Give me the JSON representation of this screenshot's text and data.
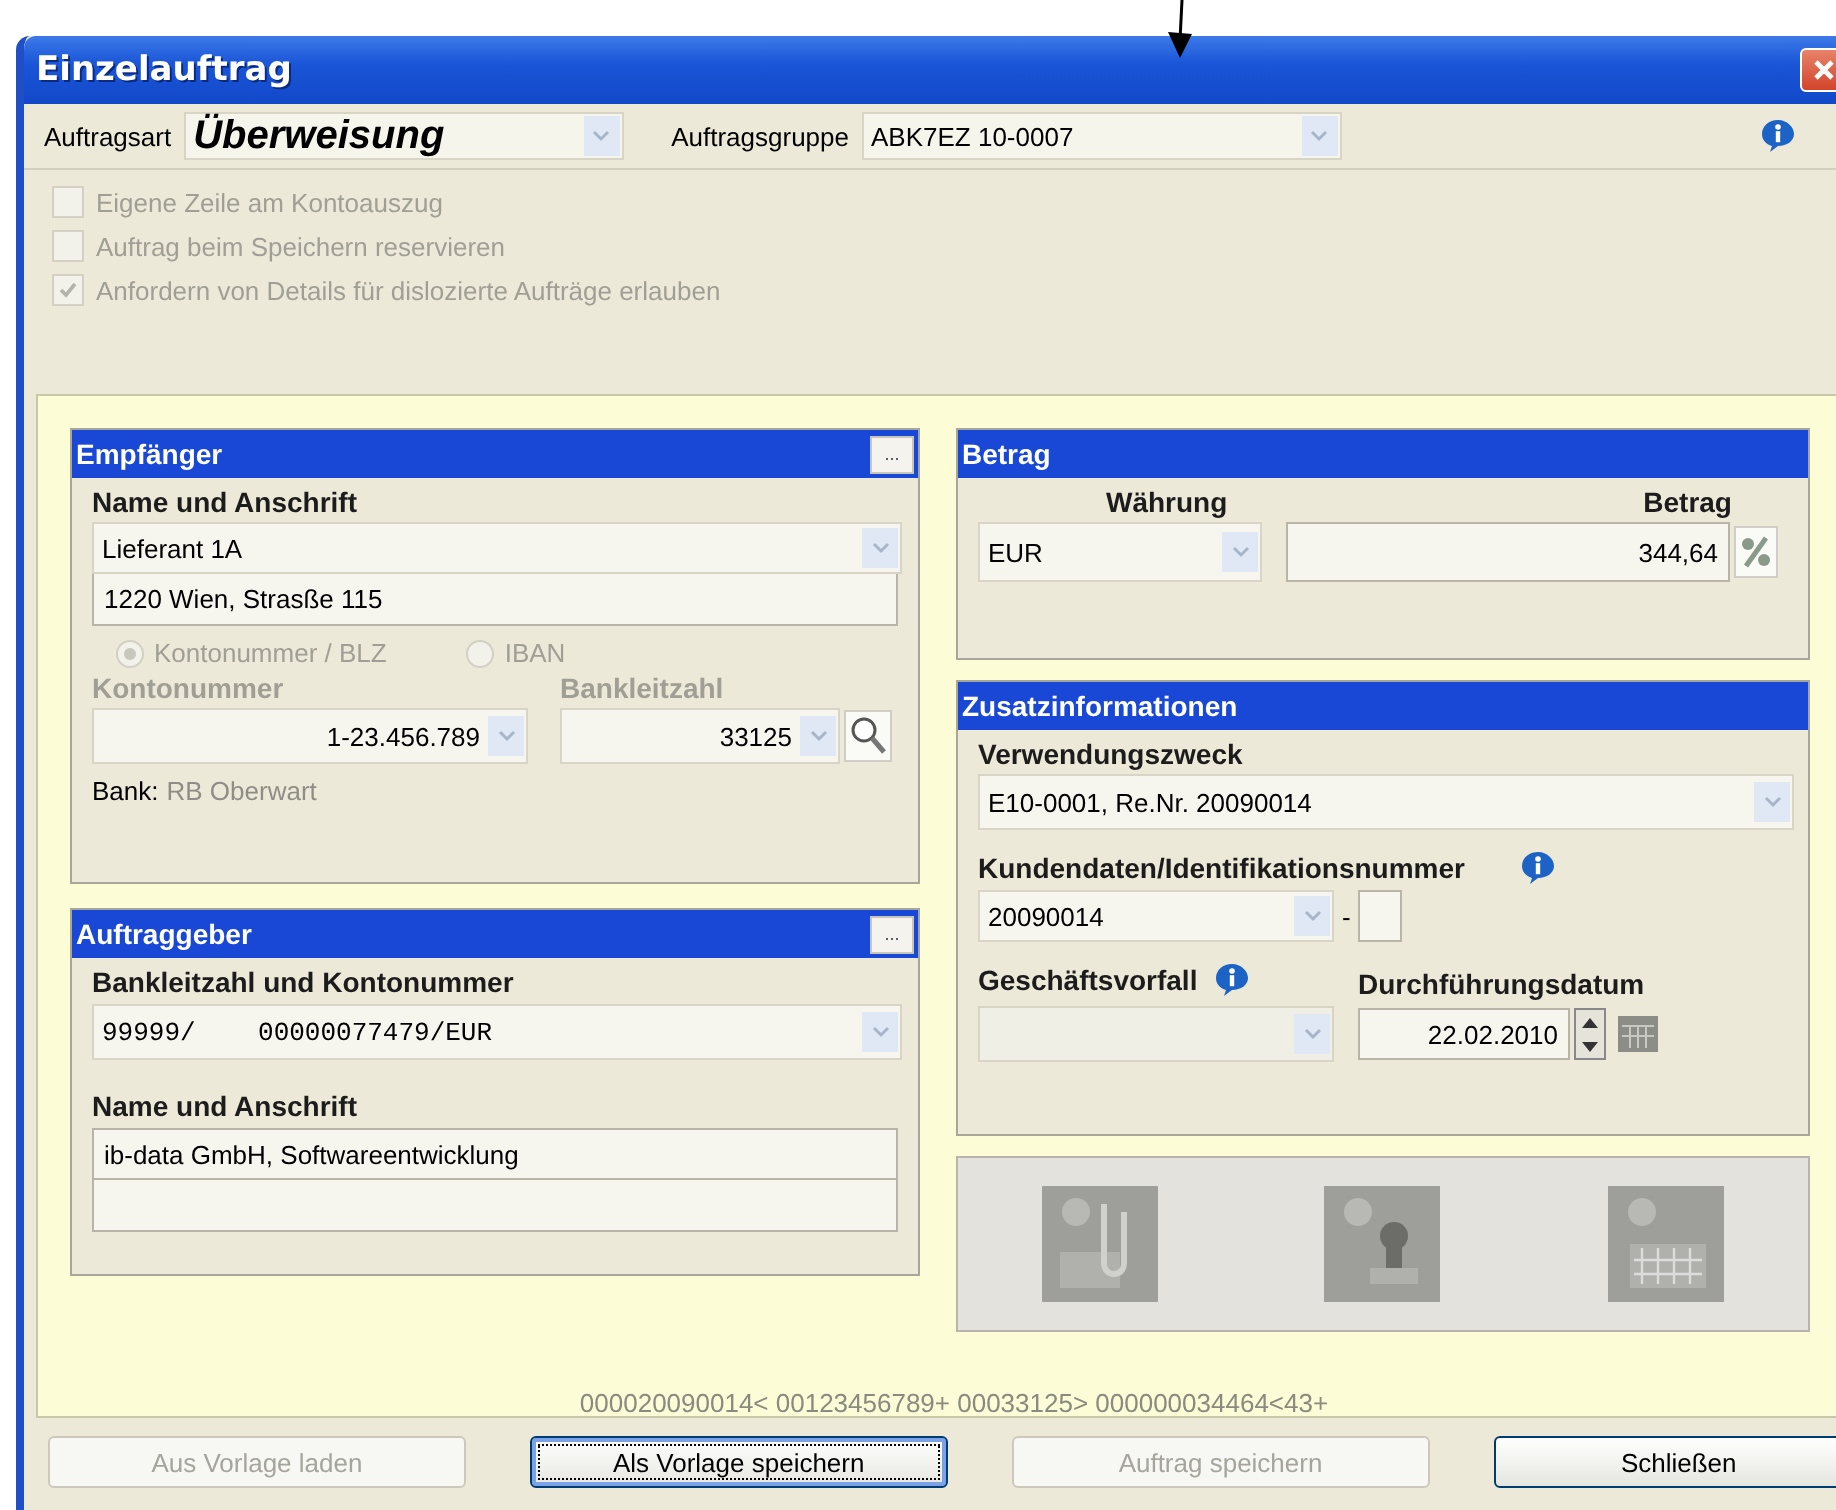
{
  "window": {
    "title": "Einzelauftrag"
  },
  "toolbar": {
    "type_label": "Auftragsart",
    "type_value": "Überweisung",
    "group_label": "Auftragsgruppe",
    "group_value": "ABK7EZ 10-0007"
  },
  "options": [
    {
      "label": "Eigene Zeile am Kontoauszug",
      "checked": false,
      "disabled": true
    },
    {
      "label": "Auftrag beim Speichern reservieren",
      "checked": false,
      "disabled": true
    },
    {
      "label": "Anfordern von Details für dislozierte Aufträge erlauben",
      "checked": true,
      "disabled": true
    }
  ],
  "recipient": {
    "title": "Empfänger",
    "more": "...",
    "name_label": "Name und Anschrift",
    "name": "Lieferant 1A",
    "address": "1220 Wien, Strasße 115",
    "account_types": [
      {
        "label": "Kontonummer / BLZ",
        "selected": true,
        "disabled": true
      },
      {
        "label": "IBAN",
        "selected": false,
        "disabled": true
      }
    ],
    "account_label": "Kontonummer",
    "account": "1-23.456.789",
    "bank_code_label": "Bankleitzahl",
    "bank_code": "33125",
    "bank_label": "Bank:",
    "bank_name": "RB Oberwart"
  },
  "orderer": {
    "title": "Auftraggeber",
    "more": "...",
    "account_label": "Bankleitzahl und Kontonummer",
    "account": "99999/    00000077479/EUR",
    "name_label": "Name und Anschrift",
    "name": "ib-data GmbH, Softwareentwicklung"
  },
  "amount": {
    "title": "Betrag",
    "currency_label": "Währung",
    "currency": "EUR",
    "amount_label": "Betrag",
    "amount": "344,64"
  },
  "extra": {
    "title": "Zusatzinformationen",
    "purpose_label": "Verwendungszweck",
    "purpose": "E10-0001, Re.Nr. 20090014",
    "customer_label": "Kundendaten/Identifikationsnummer",
    "customer": "20090014",
    "separator": "-",
    "business_label": "Geschäftsvorfall",
    "date_label": "Durchführungsdatum",
    "date": "22.02.2010"
  },
  "attachments": [
    {
      "kind": "paperclip",
      "disabled": true
    },
    {
      "kind": "stamp",
      "disabled": true
    },
    {
      "kind": "grid",
      "disabled": true
    }
  ],
  "code_line": "000020090014< 00123456789+ 00033125> 000000034464<43+",
  "buttons": [
    {
      "label": "Aus Vorlage laden",
      "disabled": true,
      "focused": false
    },
    {
      "label": "Als Vorlage speichern",
      "disabled": false,
      "focused": true
    },
    {
      "label": "Auftrag speichern",
      "disabled": true,
      "focused": false
    },
    {
      "label": "Schließen",
      "disabled": false,
      "focused": false
    }
  ]
}
